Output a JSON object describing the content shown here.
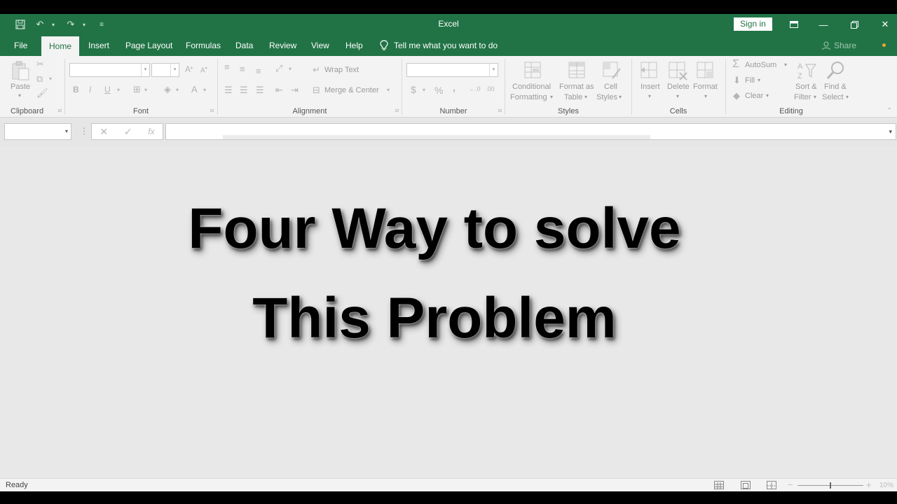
{
  "window": {
    "title": "Excel",
    "sign_in": "Sign in"
  },
  "tabs": [
    {
      "label": "File"
    },
    {
      "label": "Home"
    },
    {
      "label": "Insert"
    },
    {
      "label": "Page Layout"
    },
    {
      "label": "Formulas"
    },
    {
      "label": "Data"
    },
    {
      "label": "Review"
    },
    {
      "label": "View"
    },
    {
      "label": "Help"
    }
  ],
  "tell_me": "Tell me what you want to do",
  "share": "Share",
  "ribbon": {
    "clipboard": {
      "label": "Clipboard",
      "paste": "Paste"
    },
    "font": {
      "label": "Font",
      "bold": "B",
      "italic": "I",
      "underline": "U",
      "font_color": "A"
    },
    "alignment": {
      "label": "Alignment",
      "wrap_text": "Wrap Text",
      "merge_center": "Merge & Center"
    },
    "number": {
      "label": "Number",
      "currency": "$",
      "percent": "%",
      "comma": ","
    },
    "styles": {
      "label": "Styles",
      "conditional_1": "Conditional",
      "conditional_2": "Formatting",
      "format_table_1": "Format as",
      "format_table_2": "Table",
      "cell_styles_1": "Cell",
      "cell_styles_2": "Styles"
    },
    "cells": {
      "label": "Cells",
      "insert": "Insert",
      "delete": "Delete",
      "format": "Format"
    },
    "editing": {
      "label": "Editing",
      "autosum": "AutoSum",
      "fill": "Fill",
      "clear": "Clear",
      "sort_1": "Sort &",
      "sort_2": "Filter",
      "find_1": "Find &",
      "find_2": "Select"
    }
  },
  "formula_bar": {
    "name_box": "",
    "formula": ""
  },
  "overlay": {
    "line1": "Four Way to solve",
    "line2": "This Problem"
  },
  "status": {
    "text": "Ready",
    "zoom": "10%"
  }
}
